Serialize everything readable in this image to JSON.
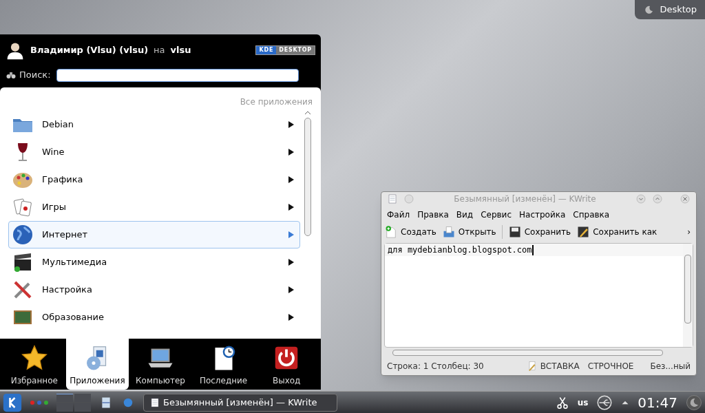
{
  "desktop_button": {
    "label": "Desktop"
  },
  "launcher": {
    "user": "Владимир (Vlsu) (vlsu)",
    "on": "на",
    "host": "vlsu",
    "badge": [
      "KDE",
      "DESKTOP"
    ],
    "search_label": "Поиск:",
    "breadcrumb": "Все приложения",
    "items": [
      {
        "label": "Debian",
        "selected": false
      },
      {
        "label": "Wine",
        "selected": false
      },
      {
        "label": "Графика",
        "selected": false
      },
      {
        "label": "Игры",
        "selected": false
      },
      {
        "label": "Интернет",
        "selected": true
      },
      {
        "label": "Мультимедиа",
        "selected": false
      },
      {
        "label": "Настройка",
        "selected": false
      },
      {
        "label": "Образование",
        "selected": false
      }
    ],
    "tabs": [
      {
        "label": "Избранное",
        "selected": false
      },
      {
        "label": "Приложения",
        "selected": true
      },
      {
        "label": "Компьютер",
        "selected": false
      },
      {
        "label": "Последние",
        "selected": false
      },
      {
        "label": "Выход",
        "selected": false
      }
    ]
  },
  "editor": {
    "title": "Безымянный [изменён] — KWrite",
    "menu": [
      "Файл",
      "Правка",
      "Вид",
      "Сервис",
      "Настройка",
      "Справка"
    ],
    "toolbar": [
      "Создать",
      "Открыть",
      "Сохранить",
      "Сохранить как"
    ],
    "more": "›",
    "text": "для mydebianblog.blogspot.com",
    "status": {
      "position": "Строка: 1 Столбец: 30",
      "mode": "ВСТАВКА",
      "wrap": "СТРОЧНОЕ",
      "file": "Без...ный"
    }
  },
  "taskbar": {
    "task": "Безымянный [изменён] — KWrite",
    "layout": "us",
    "clock": "01:47"
  }
}
